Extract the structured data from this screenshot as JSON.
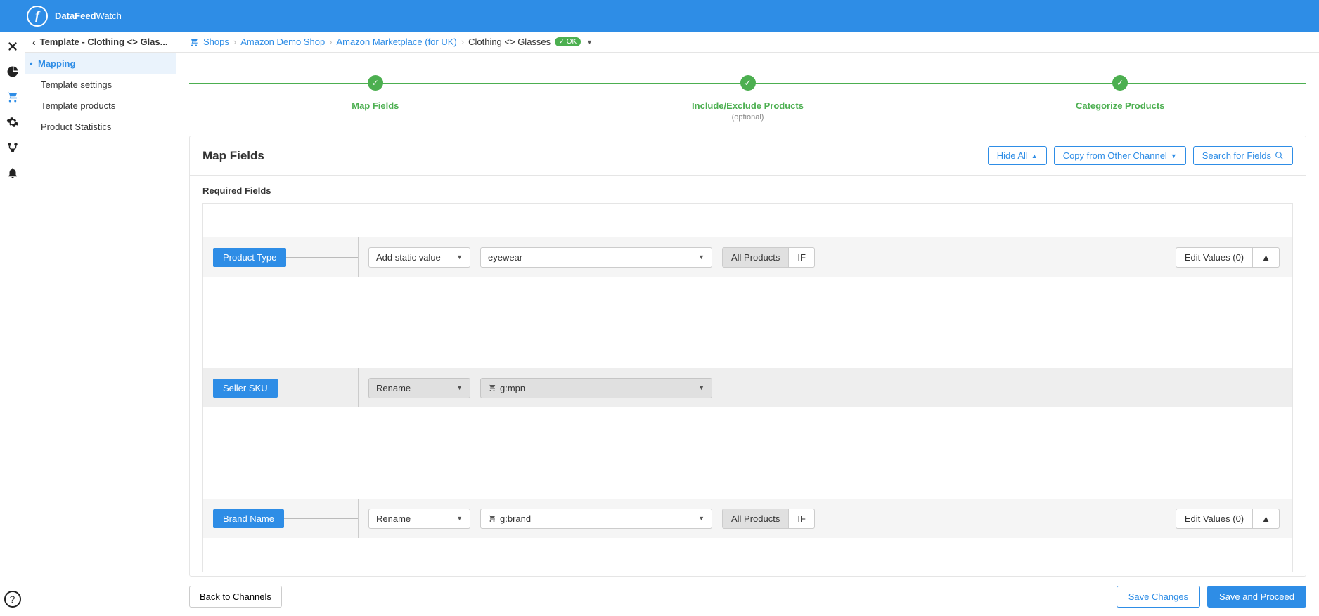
{
  "brand": {
    "bold": "DataFeed",
    "light": "Watch"
  },
  "sidebar": {
    "header": "Template - Clothing <> Glas...",
    "items": [
      {
        "label": "Mapping",
        "active": true
      },
      {
        "label": "Template settings",
        "active": false
      },
      {
        "label": "Template products",
        "active": false
      },
      {
        "label": "Product Statistics",
        "active": false
      }
    ]
  },
  "breadcrumb": {
    "shops": "Shops",
    "shop": "Amazon Demo Shop",
    "channel": "Amazon Marketplace (for UK)",
    "template": "Clothing <> Glasses",
    "status": "OK"
  },
  "stepper": [
    {
      "label": "Map Fields",
      "sublabel": ""
    },
    {
      "label": "Include/Exclude Products",
      "sublabel": "(optional)"
    },
    {
      "label": "Categorize Products",
      "sublabel": ""
    }
  ],
  "panel": {
    "title": "Map Fields",
    "actions": {
      "hide_all": "Hide All",
      "copy": "Copy from Other Channel",
      "search": "Search for Fields"
    },
    "required_label": "Required Fields",
    "fields": [
      {
        "tag": "Product Type",
        "mode": "Add static value",
        "value": "eyewear",
        "filter": "All Products",
        "if": "IF",
        "edit": "Edit Values (0)",
        "locked": false
      },
      {
        "tag": "Seller SKU",
        "mode": "Rename",
        "value": "g:mpn",
        "filter": "",
        "if": "",
        "edit": "",
        "locked": true
      },
      {
        "tag": "Brand Name",
        "mode": "Rename",
        "value": "g:brand",
        "filter": "All Products",
        "if": "IF",
        "edit": "Edit Values (0)",
        "locked": false
      }
    ]
  },
  "footer": {
    "back": "Back to Channels",
    "save": "Save Changes",
    "proceed": "Save and Proceed"
  }
}
